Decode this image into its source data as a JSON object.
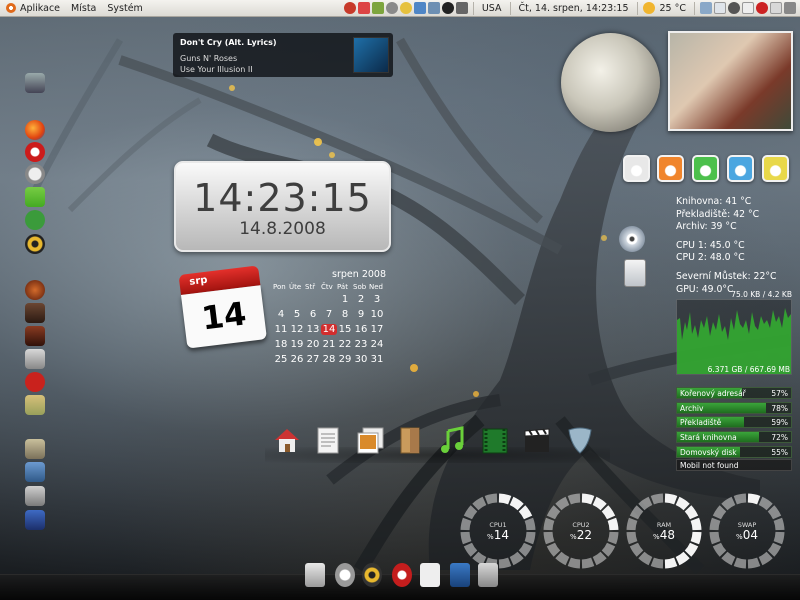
{
  "top_panel": {
    "menus": [
      "Aplikace",
      "Místa",
      "Systém"
    ],
    "keyboard_layout": "USA",
    "datetime": "Čt, 14. srpen, 14:23:15",
    "weather": "25 °C"
  },
  "music": {
    "title": "Don't Cry (Alt. Lyrics)",
    "artist": "Guns N' Roses",
    "album": "Use Your Illusion II"
  },
  "clock": {
    "time": "14:23:15",
    "date": "14.8.2008"
  },
  "calendar_icon": {
    "month": "srp",
    "day": "14"
  },
  "month_calendar": {
    "header": "srpen 2008",
    "weekdays": [
      "Pon",
      "Úte",
      "Stř",
      "Čtv",
      "Pát",
      "Sob",
      "Ned"
    ],
    "today": "14",
    "weeks": [
      [
        "",
        "",
        "",
        "",
        "1",
        "2",
        "3"
      ],
      [
        "4",
        "5",
        "6",
        "7",
        "8",
        "9",
        "10"
      ],
      [
        "11",
        "12",
        "13",
        "14",
        "15",
        "16",
        "17"
      ],
      [
        "18",
        "19",
        "20",
        "21",
        "22",
        "23",
        "24"
      ],
      [
        "25",
        "26",
        "27",
        "28",
        "29",
        "30",
        "31"
      ]
    ]
  },
  "drives": {
    "colors": [
      "#e8e8e8",
      "#f0852c",
      "#4cc04c",
      "#4ba6e0",
      "#e8d84a"
    ]
  },
  "temps": {
    "lines": [
      "Knihovna: 41 °C",
      "Překladiště: 42 °C",
      "Archiv: 39 °C",
      "CPU 1: 45.0 °C",
      "CPU 2: 48.0 °C",
      "Severní Můstek: 22°C",
      "GPU: 49.0°C"
    ]
  },
  "network": {
    "speed": "75.0 KB / 4.2 KB",
    "totals": "6.371 GB / 667.69 MB"
  },
  "disks": [
    {
      "name": "Kořenový adresář",
      "pct": "57%",
      "fill": 0.57
    },
    {
      "name": "Archiv",
      "pct": "78%",
      "fill": 0.78
    },
    {
      "name": "Překladiště",
      "pct": "59%",
      "fill": 0.59
    },
    {
      "name": "Stará knihovna",
      "pct": "72%",
      "fill": 0.72
    },
    {
      "name": "Domovský disk",
      "pct": "55%",
      "fill": 0.55
    }
  ],
  "mobil": "Mobil not found",
  "rings": [
    {
      "label": "CPU1",
      "value": "14",
      "fill": 0.14
    },
    {
      "label": "CPU2",
      "value": "22",
      "fill": 0.22
    },
    {
      "label": "RAM",
      "value": "48",
      "fill": 0.48
    },
    {
      "label": "SWAP",
      "value": "04",
      "fill": 0.04
    }
  ],
  "percent_sign": "%"
}
